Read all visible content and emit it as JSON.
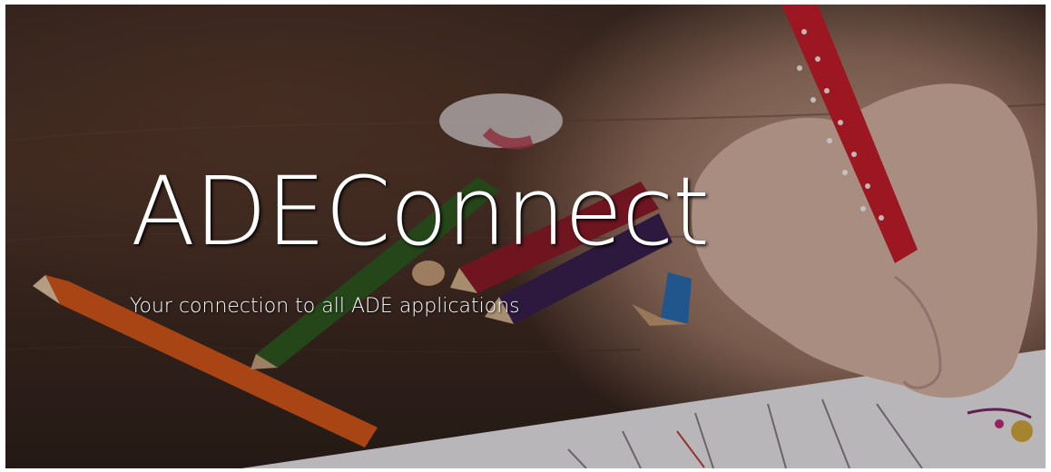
{
  "hero": {
    "title": "ADEConnect",
    "subtitle": "Your connection to all ADE applications"
  },
  "colors": {
    "text": "#ffffff",
    "background": "#3b2a23"
  },
  "background_image": {
    "subject": "hero-photo-child-drawing-with-colored-pencils"
  }
}
